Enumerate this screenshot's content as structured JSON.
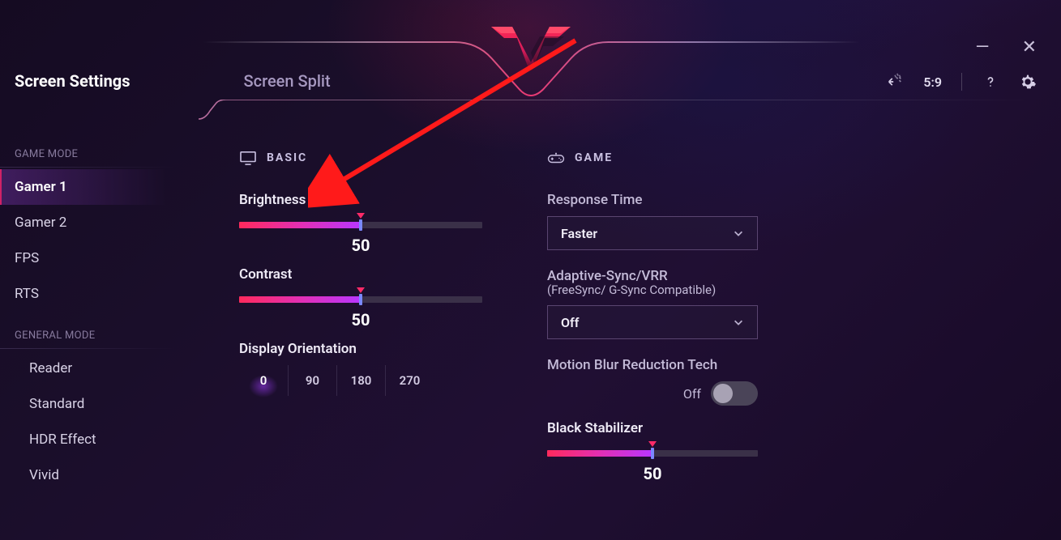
{
  "window": {
    "minimize_glyph": "—",
    "close_glyph": "✕"
  },
  "tabs": {
    "screen_settings": "Screen Settings",
    "screen_split": "Screen Split"
  },
  "toolbar": {
    "aspect_label": "5:9"
  },
  "sidebar": {
    "game_mode_heading": "GAME MODE",
    "game_items": [
      {
        "label": "Gamer 1",
        "active": true
      },
      {
        "label": "Gamer 2",
        "active": false
      },
      {
        "label": "FPS",
        "active": false
      },
      {
        "label": "RTS",
        "active": false
      }
    ],
    "general_mode_heading": "GENERAL MODE",
    "general_items": [
      {
        "label": "Reader"
      },
      {
        "label": "Standard"
      },
      {
        "label": "HDR Effect"
      },
      {
        "label": "Vivid"
      }
    ]
  },
  "basic": {
    "section_label": "BASIC",
    "brightness": {
      "label": "Brightness",
      "value": "50",
      "percent": 50
    },
    "contrast": {
      "label": "Contrast",
      "value": "50",
      "percent": 50
    },
    "orientation": {
      "label": "Display Orientation",
      "options": [
        "0",
        "90",
        "180",
        "270"
      ],
      "selected": "0"
    }
  },
  "game": {
    "section_label": "GAME",
    "response_time": {
      "label": "Response Time",
      "selected": "Faster"
    },
    "adaptive_sync": {
      "label": "Adaptive-Sync/VRR",
      "sublabel": "(FreeSync/ G-Sync Compatible)",
      "selected": "Off"
    },
    "motion_blur": {
      "label": "Motion Blur Reduction Tech",
      "state_label": "Off",
      "on": false
    },
    "black_stabilizer": {
      "label": "Black Stabilizer",
      "value": "50",
      "percent": 50
    }
  }
}
